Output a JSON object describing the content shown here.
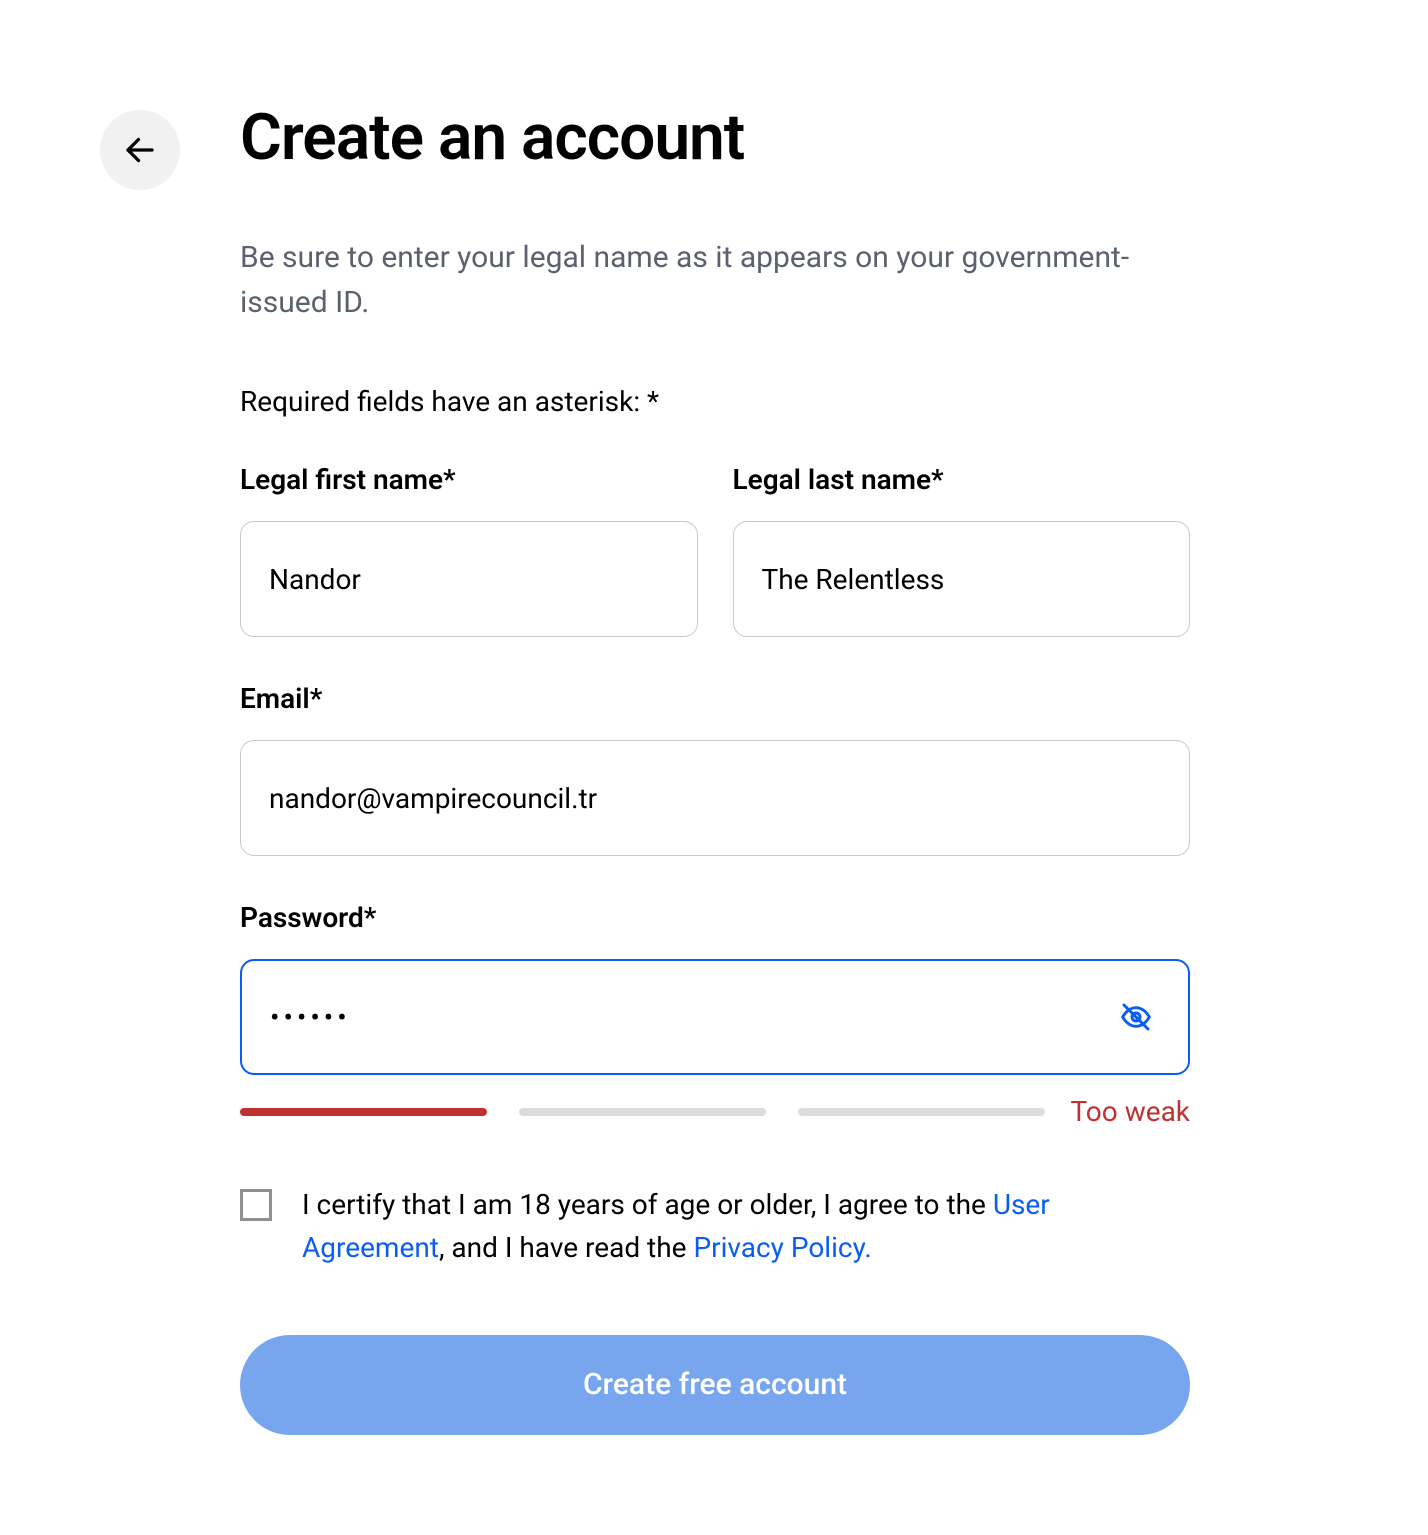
{
  "header": {
    "title": "Create an account",
    "instruction": "Be sure to enter your legal name as it appears on your government-issued ID.",
    "required_note": "Required fields have an asterisk: *"
  },
  "form": {
    "first_name": {
      "label": "Legal first name*",
      "value": "Nandor"
    },
    "last_name": {
      "label": "Legal last name*",
      "value": "The Relentless"
    },
    "email": {
      "label": "Email*",
      "value": "nandor@vampirecouncil.tr"
    },
    "password": {
      "label": "Password*",
      "value": "••••••",
      "strength_label": "Too weak",
      "strength_level": 1,
      "strength_total": 3
    },
    "consent": {
      "prefix": "I certify that I am 18 years of age or older, I agree to the ",
      "link1": "User Agreement",
      "middle": ", and I have read the ",
      "link2": "Privacy Policy."
    },
    "submit_label": "Create free account"
  },
  "colors": {
    "accent": "#0a5cf5",
    "error": "#c23131",
    "submit_bg": "#77a6ef",
    "muted": "#5b616e"
  }
}
